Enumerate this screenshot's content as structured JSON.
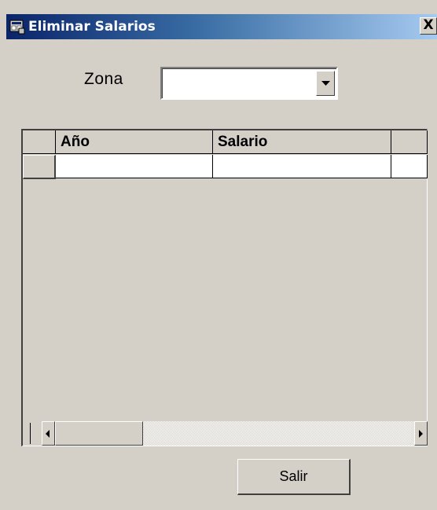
{
  "window": {
    "title": "Eliminar Salarios",
    "close_label": "X"
  },
  "form": {
    "zona_label": "Zona",
    "zona_value": ""
  },
  "grid": {
    "columns": [
      "Año",
      "Salario"
    ],
    "rows": [
      {
        "anio": "",
        "salario": ""
      }
    ]
  },
  "buttons": {
    "salir_label": "Salir"
  },
  "colors": {
    "titlebar_start": "#0a246a",
    "titlebar_end": "#a6caf0",
    "face": "#d4d0c8"
  }
}
